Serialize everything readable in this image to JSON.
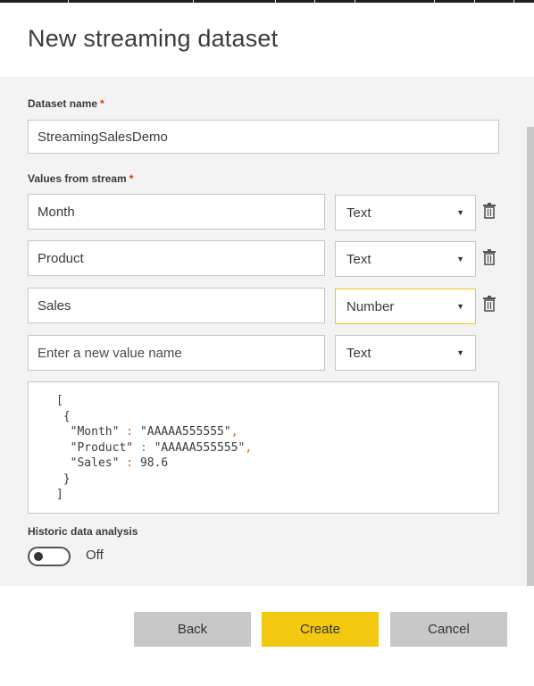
{
  "dialog": {
    "title": "New streaming dataset"
  },
  "dataset_name": {
    "label": "Dataset name",
    "required_mark": "*",
    "value": "StreamingSalesDemo"
  },
  "values_from_stream": {
    "label": "Values from stream",
    "required_mark": "*",
    "rows": [
      {
        "name": "Month",
        "type": "Text"
      },
      {
        "name": "Product",
        "type": "Text"
      },
      {
        "name": "Sales",
        "type": "Number"
      }
    ],
    "new_row": {
      "placeholder": "Enter a new value name",
      "type": "Text"
    }
  },
  "json_preview": {
    "open_bracket": "[",
    "open_brace": "{",
    "line1_key": "\"Month\"",
    "line1_value": "\"AAAAA555555\"",
    "line2_key": "\"Product\"",
    "line2_value": "\"AAAAA555555\"",
    "line3_key": "\"Sales\"",
    "line3_value": "98.6",
    "colon": ":",
    "comma": ",",
    "close_brace": "}",
    "close_bracket": "]"
  },
  "historic": {
    "label": "Historic data analysis",
    "toggle_state": "Off"
  },
  "buttons": {
    "back": "Back",
    "create": "Create",
    "cancel": "Cancel"
  },
  "colors": {
    "accent": "#f2c811",
    "required": "#d83b01",
    "panel": "#f3f3f3",
    "button_gray": "#c8c8c8"
  },
  "icons": {
    "delete": "trash-icon",
    "dropdown": "chevron-down-icon"
  }
}
